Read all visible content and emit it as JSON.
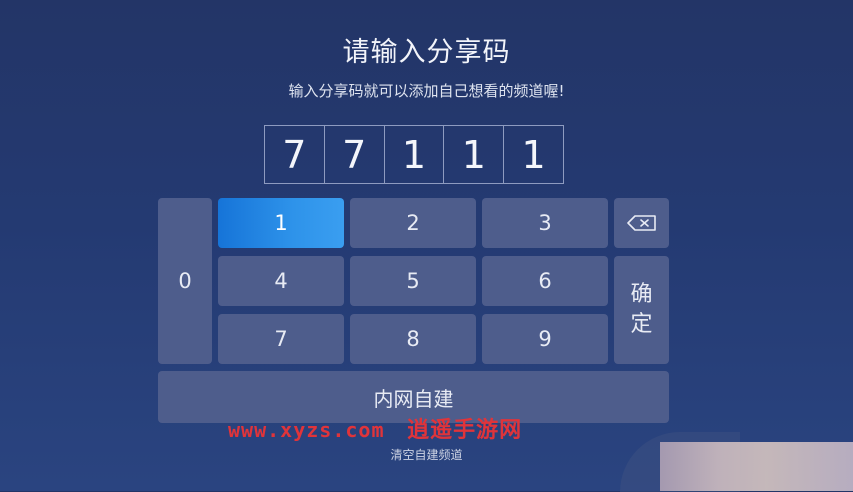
{
  "header": {
    "title": "请输入分享码",
    "subtitle": "输入分享码就可以添加自己想看的频道喔!"
  },
  "code": {
    "digits": [
      "7",
      "7",
      "1",
      "1",
      "1"
    ]
  },
  "keypad": {
    "zero": "0",
    "digits": [
      "1",
      "2",
      "3",
      "4",
      "5",
      "6",
      "7",
      "8",
      "9"
    ],
    "selected": "1",
    "backspace_icon": "backspace-icon",
    "confirm_char_1": "确",
    "confirm_char_2": "定",
    "intranet_label": "内网自建"
  },
  "footer": {
    "clear_link": "清空自建频道"
  },
  "watermark": {
    "url": "www.xyzs.com",
    "name": "逍遥手游网"
  },
  "colors": {
    "background": "#243a72",
    "key": "#4e5d8c",
    "active_key": "#2e93ea",
    "watermark": "#e0343a"
  }
}
